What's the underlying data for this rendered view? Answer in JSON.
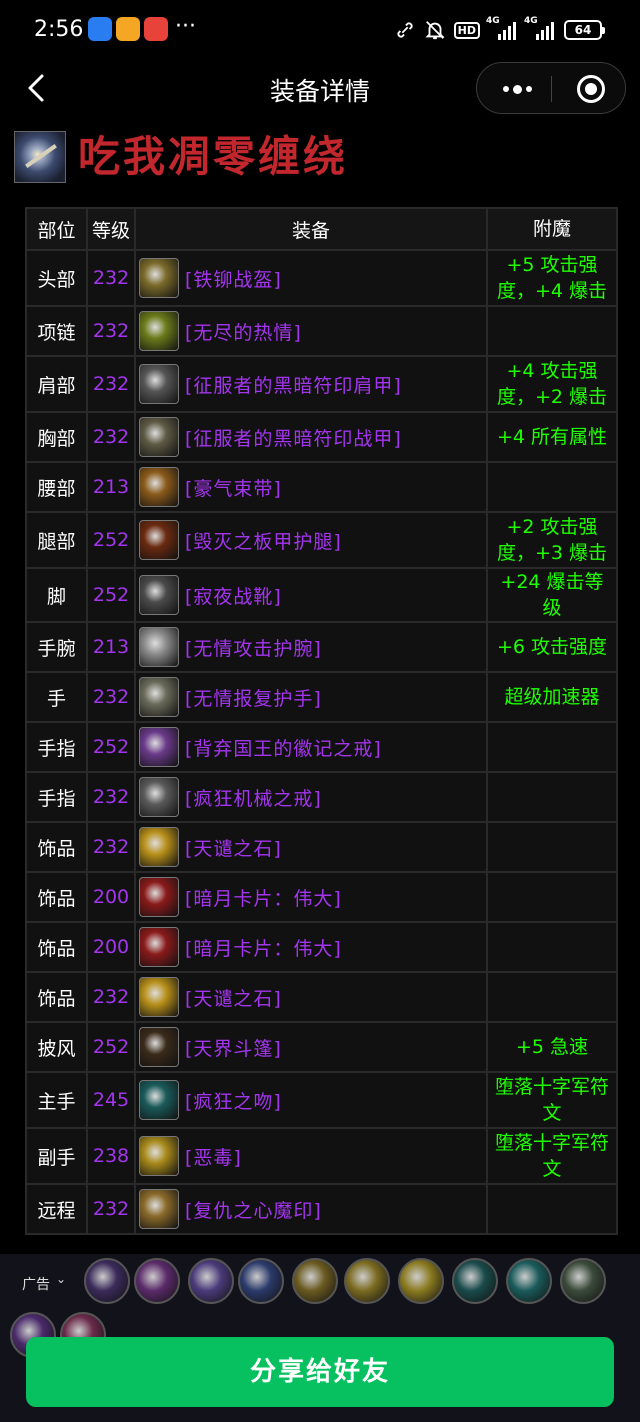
{
  "status_bar": {
    "time": "2:56",
    "more": "···",
    "hd": "HD",
    "net1": "4G",
    "net2": "4G",
    "battery": "64"
  },
  "nav": {
    "title": "装备详情"
  },
  "header": {
    "character_name": "吃我凋零缠绕"
  },
  "table": {
    "columns": [
      "部位",
      "等级",
      "装备",
      "附魔"
    ],
    "rows": [
      {
        "slot": "头部",
        "level": "232",
        "item": "[铁铆战盔]",
        "enchant": "+5 攻击强度，+4 爆击",
        "icon": "helmet-icon",
        "icon_color": "#7a6a2a"
      },
      {
        "slot": "项链",
        "level": "232",
        "item": "[无尽的热情]",
        "enchant": "",
        "icon": "necklace-icon",
        "icon_color": "#6b7a1a"
      },
      {
        "slot": "肩部",
        "level": "232",
        "item": "[征服者的黑暗符印肩甲]",
        "enchant": "+4 攻击强度，+2 爆击",
        "icon": "shoulder-icon",
        "icon_color": "#555555"
      },
      {
        "slot": "胸部",
        "level": "232",
        "item": "[征服者的黑暗符印战甲]",
        "enchant": "+4 所有属性",
        "icon": "chest-icon",
        "icon_color": "#5e5a44"
      },
      {
        "slot": "腰部",
        "level": "213",
        "item": "[豪气束带]",
        "enchant": "",
        "icon": "belt-icon",
        "icon_color": "#8a5a1a"
      },
      {
        "slot": "腿部",
        "level": "252",
        "item": "[毁灭之板甲护腿]",
        "enchant": "+2 攻击强度，+3 爆击",
        "icon": "legs-icon",
        "icon_color": "#6a2a10"
      },
      {
        "slot": "脚",
        "level": "252",
        "item": "[寂夜战靴]",
        "enchant": "+24 爆击等级",
        "icon": "boots-icon",
        "icon_color": "#4a4a4a"
      },
      {
        "slot": "手腕",
        "level": "213",
        "item": "[无情攻击护腕]",
        "enchant": "+6 攻击强度",
        "icon": "bracer-icon",
        "icon_color": "#8a8a8a"
      },
      {
        "slot": "手",
        "level": "232",
        "item": "[无情报复护手]",
        "enchant": "超级加速器",
        "icon": "gloves-icon",
        "icon_color": "#6a6a5a"
      },
      {
        "slot": "手指",
        "level": "252",
        "item": "[背弃国王的徽记之戒]",
        "enchant": "",
        "icon": "ring-icon",
        "icon_color": "#6a3a8a"
      },
      {
        "slot": "手指",
        "level": "232",
        "item": "[疯狂机械之戒]",
        "enchant": "",
        "icon": "ring-icon",
        "icon_color": "#5a5a5a"
      },
      {
        "slot": "饰品",
        "level": "232",
        "item": "[天谴之石]",
        "enchant": "",
        "icon": "stone-icon",
        "icon_color": "#b8901a"
      },
      {
        "slot": "饰品",
        "level": "200",
        "item": "[暗月卡片：伟大]",
        "enchant": "",
        "icon": "card-icon",
        "icon_color": "#8a1a1a"
      },
      {
        "slot": "饰品",
        "level": "200",
        "item": "[暗月卡片：伟大]",
        "enchant": "",
        "icon": "card-icon",
        "icon_color": "#8a1a1a"
      },
      {
        "slot": "饰品",
        "level": "232",
        "item": "[天谴之石]",
        "enchant": "",
        "icon": "stone-icon",
        "icon_color": "#b8901a"
      },
      {
        "slot": "披风",
        "level": "252",
        "item": "[天界斗篷]",
        "enchant": "+5 急速",
        "icon": "cloak-icon",
        "icon_color": "#3a2a1a"
      },
      {
        "slot": "主手",
        "level": "245",
        "item": "[疯狂之吻]",
        "enchant": "堕落十字军符文",
        "icon": "dagger-icon",
        "icon_color": "#1a5a5a"
      },
      {
        "slot": "副手",
        "level": "238",
        "item": "[恶毒]",
        "enchant": "堕落十字军符文",
        "icon": "blade-icon",
        "icon_color": "#a88a1a"
      },
      {
        "slot": "远程",
        "level": "232",
        "item": "[复仇之心魔印]",
        "enchant": "",
        "icon": "sigil-icon",
        "icon_color": "#8a6a2a"
      }
    ]
  },
  "banner": {
    "ad_label": "广告",
    "share_label": "分享给好友"
  },
  "colors": {
    "epic_purple": "#a335ee",
    "enchant_green": "#1eff00",
    "name_red": "#c1272d",
    "share_green": "#07c160"
  }
}
